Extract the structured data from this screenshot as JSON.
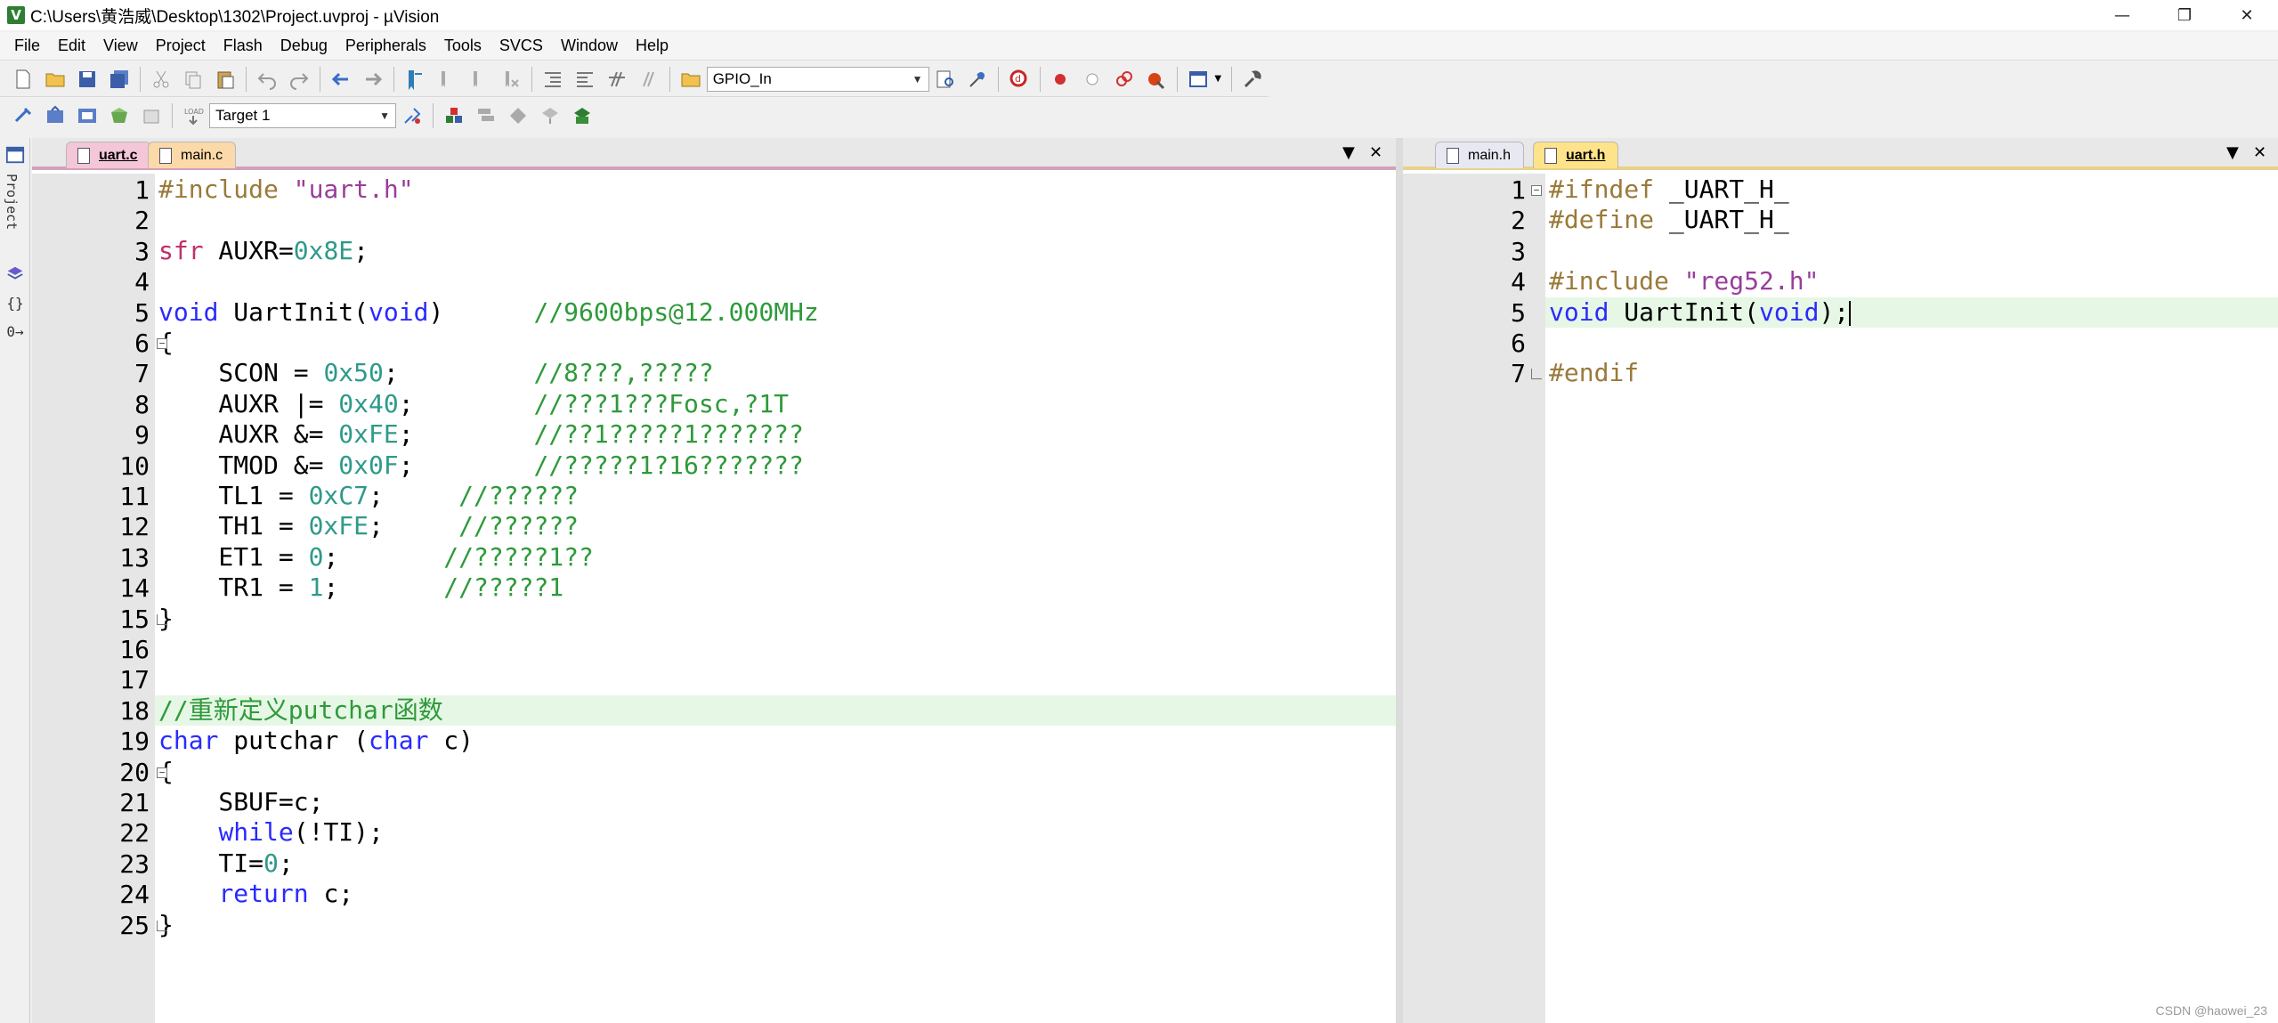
{
  "window": {
    "title": "C:\\Users\\黄浩威\\Desktop\\1302\\Project.uvproj - µVision",
    "app_icon": "V",
    "controls": [
      "—",
      "❐",
      "✕"
    ]
  },
  "menu": [
    "File",
    "Edit",
    "View",
    "Project",
    "Flash",
    "Debug",
    "Peripherals",
    "Tools",
    "SVCS",
    "Window",
    "Help"
  ],
  "toolbar": {
    "find_combo": "GPIO_In",
    "target_combo": "Target 1"
  },
  "left_strip": {
    "label": "Project",
    "icons": [
      "{}",
      "0→"
    ]
  },
  "left_pane": {
    "tabs": [
      {
        "label": "uart.c",
        "active": true
      },
      {
        "label": "main.c",
        "active": false
      }
    ],
    "controls": [
      "▼",
      "✕"
    ],
    "lines": [
      {
        "n": "1",
        "parts": [
          [
            "pp",
            "#include "
          ],
          [
            "str",
            "\"uart.h\""
          ]
        ]
      },
      {
        "n": "2",
        "parts": []
      },
      {
        "n": "3",
        "parts": [
          [
            "ty",
            "sfr"
          ],
          [
            "",
            " AUXR="
          ],
          [
            "num",
            "0x8E"
          ],
          [
            "",
            ";"
          ]
        ]
      },
      {
        "n": "4",
        "parts": []
      },
      {
        "n": "5",
        "parts": [
          [
            "kw",
            "void"
          ],
          [
            "",
            " UartInit("
          ],
          [
            "kw",
            "void"
          ],
          [
            "",
            ")      "
          ],
          [
            "cm",
            "//9600bps@12.000MHz"
          ]
        ]
      },
      {
        "n": "6",
        "parts": [
          [
            "",
            "{"
          ]
        ],
        "fold": "⊟"
      },
      {
        "n": "7",
        "parts": [
          [
            "",
            "    SCON = "
          ],
          [
            "num",
            "0x50"
          ],
          [
            "",
            ";         "
          ],
          [
            "cm",
            "//8???,?????"
          ]
        ]
      },
      {
        "n": "8",
        "parts": [
          [
            "",
            "    AUXR |= "
          ],
          [
            "num",
            "0x40"
          ],
          [
            "",
            ";        "
          ],
          [
            "cm",
            "//???1???Fosc,?1T"
          ]
        ]
      },
      {
        "n": "9",
        "parts": [
          [
            "",
            "    AUXR &= "
          ],
          [
            "num",
            "0xFE"
          ],
          [
            "",
            ";        "
          ],
          [
            "cm",
            "//??1?????1???????"
          ]
        ]
      },
      {
        "n": "10",
        "parts": [
          [
            "",
            "    TMOD &= "
          ],
          [
            "num",
            "0x0F"
          ],
          [
            "",
            ";        "
          ],
          [
            "cm",
            "//?????1?16???????"
          ]
        ]
      },
      {
        "n": "11",
        "parts": [
          [
            "",
            "    TL1 = "
          ],
          [
            "num",
            "0xC7"
          ],
          [
            "",
            ";     "
          ],
          [
            "cm",
            "//??????"
          ]
        ]
      },
      {
        "n": "12",
        "parts": [
          [
            "",
            "    TH1 = "
          ],
          [
            "num",
            "0xFE"
          ],
          [
            "",
            ";     "
          ],
          [
            "cm",
            "//??????"
          ]
        ]
      },
      {
        "n": "13",
        "parts": [
          [
            "",
            "    ET1 = "
          ],
          [
            "num",
            "0"
          ],
          [
            "",
            ";       "
          ],
          [
            "cm",
            "//?????1??"
          ]
        ]
      },
      {
        "n": "14",
        "parts": [
          [
            "",
            "    TR1 = "
          ],
          [
            "num",
            "1"
          ],
          [
            "",
            ";       "
          ],
          [
            "cm",
            "//?????1"
          ]
        ]
      },
      {
        "n": "15",
        "parts": [
          [
            "",
            "}"
          ]
        ],
        "fold": "└"
      },
      {
        "n": "16",
        "parts": []
      },
      {
        "n": "17",
        "parts": []
      },
      {
        "n": "18",
        "parts": [
          [
            "cm",
            "//重新定义putchar函数"
          ]
        ],
        "highlight": true
      },
      {
        "n": "19",
        "parts": [
          [
            "kw",
            "char"
          ],
          [
            "",
            " putchar ("
          ],
          [
            "kw",
            "char"
          ],
          [
            "",
            " c)"
          ]
        ]
      },
      {
        "n": "20",
        "parts": [
          [
            "",
            "{"
          ]
        ],
        "fold": "⊟"
      },
      {
        "n": "21",
        "parts": [
          [
            "",
            "    SBUF=c;"
          ]
        ]
      },
      {
        "n": "22",
        "parts": [
          [
            "",
            "    "
          ],
          [
            "kw",
            "while"
          ],
          [
            "",
            "(!TI);"
          ]
        ]
      },
      {
        "n": "23",
        "parts": [
          [
            "",
            "    TI="
          ],
          [
            "num",
            "0"
          ],
          [
            "",
            ";"
          ]
        ]
      },
      {
        "n": "24",
        "parts": [
          [
            "",
            "    "
          ],
          [
            "kw",
            "return"
          ],
          [
            "",
            " c;"
          ]
        ]
      },
      {
        "n": "25",
        "parts": [
          [
            "",
            "}"
          ]
        ],
        "fold": "└"
      }
    ]
  },
  "right_pane": {
    "tabs": [
      {
        "label": "main.h",
        "active": false
      },
      {
        "label": "uart.h",
        "active": true
      }
    ],
    "controls": [
      "▼",
      "✕"
    ],
    "lines": [
      {
        "n": "1",
        "parts": [
          [
            "pp",
            "#ifndef "
          ],
          [
            "",
            "_UART_H_"
          ]
        ],
        "fold": "⊟"
      },
      {
        "n": "2",
        "parts": [
          [
            "pp",
            "#define "
          ],
          [
            "",
            "_UART_H_"
          ]
        ]
      },
      {
        "n": "3",
        "parts": []
      },
      {
        "n": "4",
        "parts": [
          [
            "pp",
            "#include "
          ],
          [
            "str",
            "\"reg52.h\""
          ]
        ]
      },
      {
        "n": "5",
        "parts": [
          [
            "kw",
            "void"
          ],
          [
            "",
            " UartInit("
          ],
          [
            "kw",
            "void"
          ],
          [
            "",
            ");"
          ]
        ],
        "highlight": true,
        "cursor": true
      },
      {
        "n": "6",
        "parts": []
      },
      {
        "n": "7",
        "parts": [
          [
            "pp",
            "#endif"
          ]
        ],
        "fold": "└"
      }
    ]
  },
  "watermark": "CSDN @haowei_23"
}
